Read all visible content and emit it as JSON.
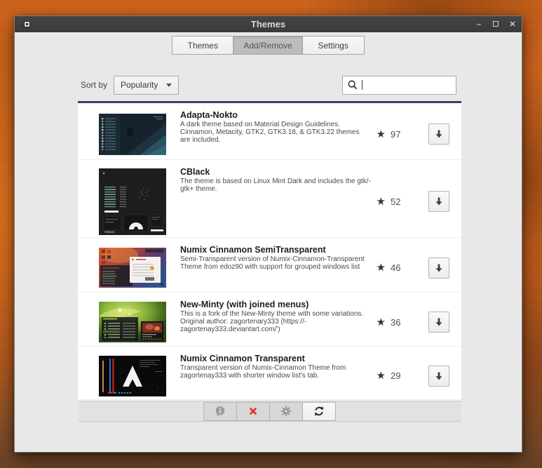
{
  "window": {
    "title": "Themes",
    "controls": {
      "minimize": "–",
      "close": "✕"
    }
  },
  "tabs": [
    {
      "label": "Themes",
      "active": false
    },
    {
      "label": "Add/Remove",
      "active": true
    },
    {
      "label": "Settings",
      "active": false
    }
  ],
  "sort": {
    "label": "Sort by",
    "selected": "Popularity"
  },
  "search": {
    "value": ""
  },
  "icons": {
    "star": "★"
  },
  "themes": [
    {
      "name": "Adapta-Nokto",
      "description": "A dark theme based on Material Design Guidelines.\nCinnamon, Metacity, GTK2, GTK3.18, & GTK3.22 themes\nare included.",
      "rating": 97,
      "thumb": "adapta"
    },
    {
      "name": "CBlack",
      "description": "The theme is based on Linux Mint Dark and includes the gtk/-\ngtk+ theme.",
      "rating": 52,
      "thumb": "cblack"
    },
    {
      "name": "Numix Cinnamon SemiTransparent",
      "description": "Semi-Transparent version of Numix-Cinnamon-Transparent\nTheme from edoz90 with support for grouped windows list",
      "rating": 46,
      "thumb": "numix-semi"
    },
    {
      "name": "New-Minty (with joined menus)",
      "description": "This is a fork of the New-Minty theme with some variations.\nOriginal author: zagortenary333 (https://-\nzagortenay333.deviantart.com/')",
      "rating": 36,
      "thumb": "minty"
    },
    {
      "name": "Numix Cinnamon Transparent",
      "description": "Transparent version of Numix-Cinnamon Theme from\nzagortenay333 with shorter window list's tab.",
      "rating": 29,
      "thumb": "numix-trans"
    }
  ],
  "toolbar": {
    "buttons": [
      {
        "icon": "info-icon",
        "enabled": false
      },
      {
        "icon": "delete-icon",
        "enabled": true
      },
      {
        "icon": "gear-icon",
        "enabled": false
      },
      {
        "icon": "refresh-icon",
        "enabled": true
      }
    ]
  }
}
